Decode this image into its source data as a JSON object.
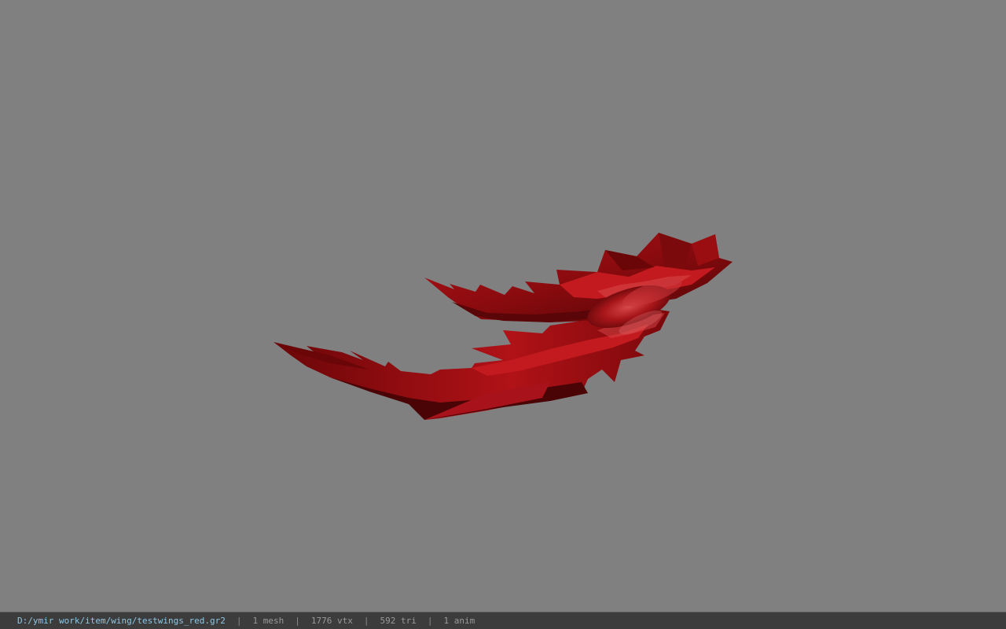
{
  "viewport": {
    "background": "#808080",
    "model_colors": {
      "base": "#8e0c0e",
      "dark": "#4a0406",
      "light": "#c41a1c",
      "highlight": "#e86a6a"
    }
  },
  "status_bar": {
    "file_path": "D:/ymir work/item/wing/testwings_red.gr2",
    "separator": "|",
    "mesh_count": "1 mesh",
    "vertex_count": "1776 vtx",
    "triangle_count": "592 tri",
    "anim_count": "1 anim"
  }
}
